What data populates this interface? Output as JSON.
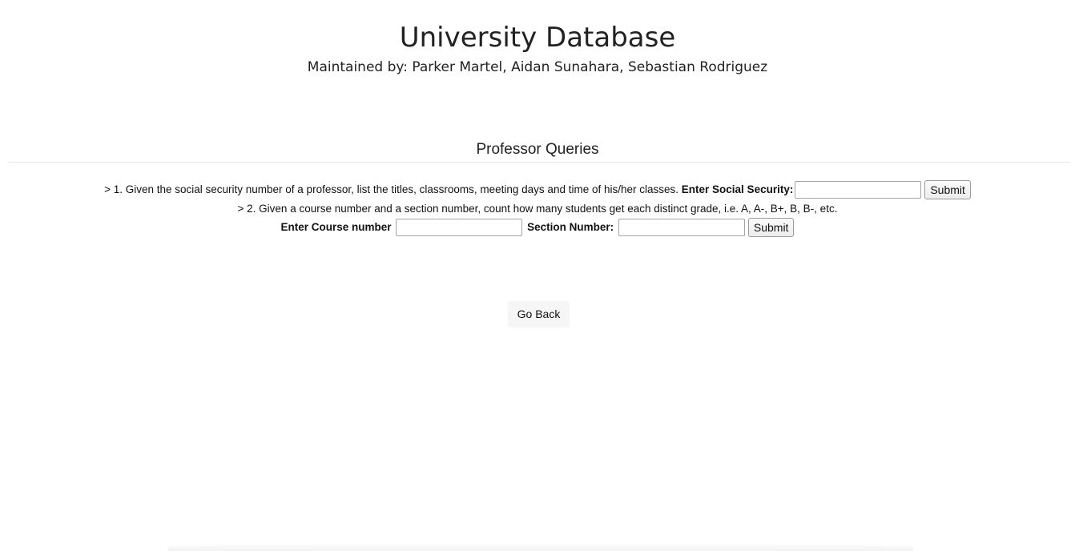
{
  "header": {
    "title": "University Database",
    "maintainers": "Maintained by: Parker Martel, Aidan Sunahara, Sebastian Rodriguez"
  },
  "section": {
    "title": "Professor Queries"
  },
  "query1": {
    "description": "> 1. Given the social security number of a professor, list the titles, classrooms, meeting days and time of his/her classes.",
    "ssn_label": "Enter Social Security:",
    "ssn_value": "",
    "submit_label": "Submit"
  },
  "query2": {
    "description": "> 2. Given a course number and a section number, count how many students get each distinct grade, i.e. A, A-, B+, B, B-, etc.",
    "course_label": "Enter Course number",
    "course_value": "",
    "section_label": "Section Number:",
    "section_value": "",
    "submit_label": "Submit"
  },
  "navigation": {
    "back_label": "Go Back"
  }
}
